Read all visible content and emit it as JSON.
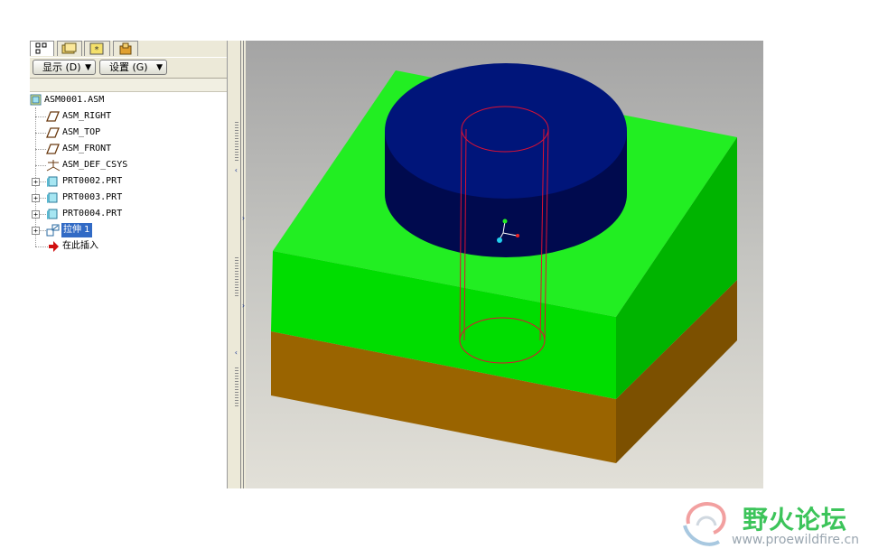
{
  "toolbar": {
    "show_label": "显示 (D)",
    "settings_label": "设置 (G)"
  },
  "tree": {
    "items": [
      {
        "label": "ASM0001.ASM",
        "icon": "assembly-icon"
      },
      {
        "label": "ASM_RIGHT",
        "icon": "datum-plane-icon"
      },
      {
        "label": "ASM_TOP",
        "icon": "datum-plane-icon"
      },
      {
        "label": "ASM_FRONT",
        "icon": "datum-plane-icon"
      },
      {
        "label": "ASM_DEF_CSYS",
        "icon": "coordinate-system-icon"
      },
      {
        "label": "PRT0002.PRT",
        "icon": "part-icon"
      },
      {
        "label": "PRT0003.PRT",
        "icon": "part-icon"
      },
      {
        "label": "PRT0004.PRT",
        "icon": "part-icon"
      },
      {
        "label": "拉伸 1",
        "icon": "extrude-icon",
        "selected": true
      },
      {
        "label": "在此插入",
        "icon": "insert-here-arrow-icon"
      }
    ]
  },
  "model": {
    "colors": {
      "base_block": "#9a6400",
      "middle_block_top": "#22ee22",
      "middle_block_front": "#00dd00",
      "middle_block_side": "#00b400",
      "cylinder_top": "#00157a",
      "cylinder_side": "#000a4e",
      "cut_outline": "#dd1133"
    }
  },
  "watermark": {
    "title": "野火论坛",
    "url": "www.proewildfire.cn"
  }
}
